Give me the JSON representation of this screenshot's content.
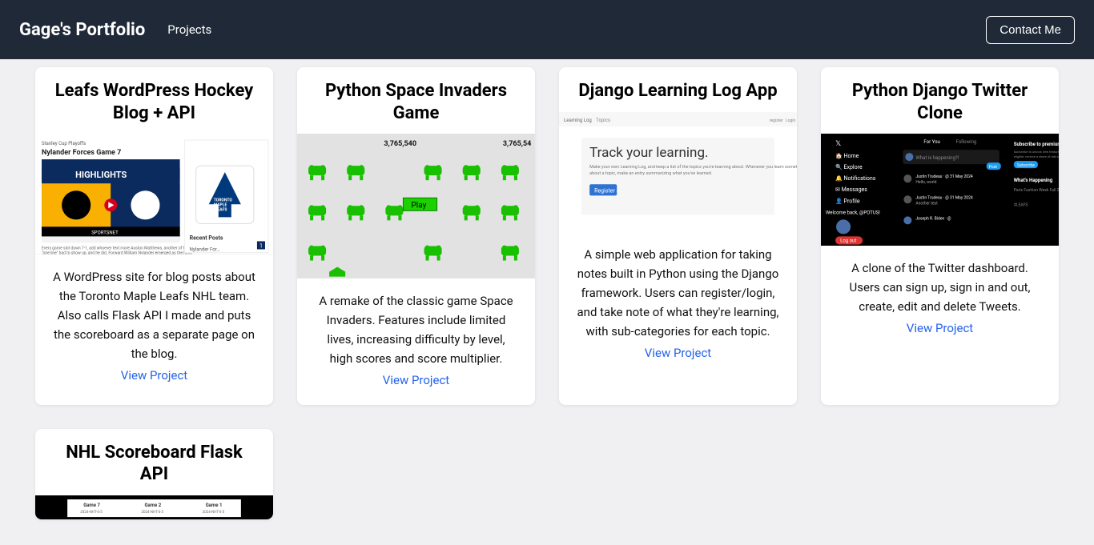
{
  "nav": {
    "brand": "Gage's Portfolio",
    "projects_label": "Projects",
    "contact_label": "Contact Me"
  },
  "cards": [
    {
      "title": "Leafs WordPress Hockey Blog + API",
      "desc": "A WordPress site for blog posts about the Toronto Maple Leafs NHL team. Also calls Flask API I made and puts the scoreboard as a separate page on the blog.",
      "link": "View Project"
    },
    {
      "title": "Python Space Invaders Game",
      "desc": "A remake of the classic game Space Invaders. Features include limited lives, increasing difficulty by level, high scores and score multiplier.",
      "link": "View Project"
    },
    {
      "title": "Django Learning Log App",
      "desc": "A simple web application for taking notes built in Python using the Django framework. Users can register/login, and take note of what they're learning, with sub-categories for each topic.",
      "link": "View Project"
    },
    {
      "title": "Python Django Twitter Clone",
      "desc": "A clone of the Twitter dashboard. Users can sign up, sign in and out, create, edit and delete Tweets.",
      "link": "View Project"
    },
    {
      "title": "NHL Scoreboard Flask API",
      "desc": "",
      "link": ""
    }
  ]
}
